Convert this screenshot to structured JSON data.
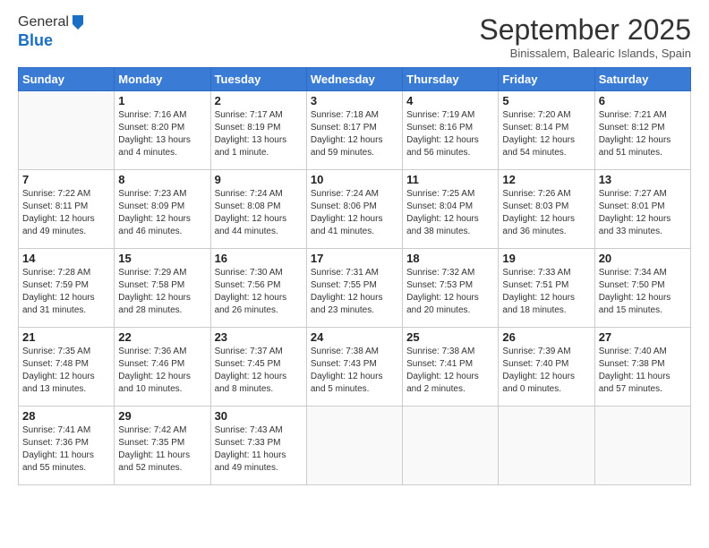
{
  "header": {
    "logo_line1": "General",
    "logo_line2": "Blue",
    "month_title": "September 2025",
    "location": "Binissalem, Balearic Islands, Spain"
  },
  "days_of_week": [
    "Sunday",
    "Monday",
    "Tuesday",
    "Wednesday",
    "Thursday",
    "Friday",
    "Saturday"
  ],
  "weeks": [
    [
      {
        "day": "",
        "info": ""
      },
      {
        "day": "1",
        "info": "Sunrise: 7:16 AM\nSunset: 8:20 PM\nDaylight: 13 hours\nand 4 minutes."
      },
      {
        "day": "2",
        "info": "Sunrise: 7:17 AM\nSunset: 8:19 PM\nDaylight: 13 hours\nand 1 minute."
      },
      {
        "day": "3",
        "info": "Sunrise: 7:18 AM\nSunset: 8:17 PM\nDaylight: 12 hours\nand 59 minutes."
      },
      {
        "day": "4",
        "info": "Sunrise: 7:19 AM\nSunset: 8:16 PM\nDaylight: 12 hours\nand 56 minutes."
      },
      {
        "day": "5",
        "info": "Sunrise: 7:20 AM\nSunset: 8:14 PM\nDaylight: 12 hours\nand 54 minutes."
      },
      {
        "day": "6",
        "info": "Sunrise: 7:21 AM\nSunset: 8:12 PM\nDaylight: 12 hours\nand 51 minutes."
      }
    ],
    [
      {
        "day": "7",
        "info": "Sunrise: 7:22 AM\nSunset: 8:11 PM\nDaylight: 12 hours\nand 49 minutes."
      },
      {
        "day": "8",
        "info": "Sunrise: 7:23 AM\nSunset: 8:09 PM\nDaylight: 12 hours\nand 46 minutes."
      },
      {
        "day": "9",
        "info": "Sunrise: 7:24 AM\nSunset: 8:08 PM\nDaylight: 12 hours\nand 44 minutes."
      },
      {
        "day": "10",
        "info": "Sunrise: 7:24 AM\nSunset: 8:06 PM\nDaylight: 12 hours\nand 41 minutes."
      },
      {
        "day": "11",
        "info": "Sunrise: 7:25 AM\nSunset: 8:04 PM\nDaylight: 12 hours\nand 38 minutes."
      },
      {
        "day": "12",
        "info": "Sunrise: 7:26 AM\nSunset: 8:03 PM\nDaylight: 12 hours\nand 36 minutes."
      },
      {
        "day": "13",
        "info": "Sunrise: 7:27 AM\nSunset: 8:01 PM\nDaylight: 12 hours\nand 33 minutes."
      }
    ],
    [
      {
        "day": "14",
        "info": "Sunrise: 7:28 AM\nSunset: 7:59 PM\nDaylight: 12 hours\nand 31 minutes."
      },
      {
        "day": "15",
        "info": "Sunrise: 7:29 AM\nSunset: 7:58 PM\nDaylight: 12 hours\nand 28 minutes."
      },
      {
        "day": "16",
        "info": "Sunrise: 7:30 AM\nSunset: 7:56 PM\nDaylight: 12 hours\nand 26 minutes."
      },
      {
        "day": "17",
        "info": "Sunrise: 7:31 AM\nSunset: 7:55 PM\nDaylight: 12 hours\nand 23 minutes."
      },
      {
        "day": "18",
        "info": "Sunrise: 7:32 AM\nSunset: 7:53 PM\nDaylight: 12 hours\nand 20 minutes."
      },
      {
        "day": "19",
        "info": "Sunrise: 7:33 AM\nSunset: 7:51 PM\nDaylight: 12 hours\nand 18 minutes."
      },
      {
        "day": "20",
        "info": "Sunrise: 7:34 AM\nSunset: 7:50 PM\nDaylight: 12 hours\nand 15 minutes."
      }
    ],
    [
      {
        "day": "21",
        "info": "Sunrise: 7:35 AM\nSunset: 7:48 PM\nDaylight: 12 hours\nand 13 minutes."
      },
      {
        "day": "22",
        "info": "Sunrise: 7:36 AM\nSunset: 7:46 PM\nDaylight: 12 hours\nand 10 minutes."
      },
      {
        "day": "23",
        "info": "Sunrise: 7:37 AM\nSunset: 7:45 PM\nDaylight: 12 hours\nand 8 minutes."
      },
      {
        "day": "24",
        "info": "Sunrise: 7:38 AM\nSunset: 7:43 PM\nDaylight: 12 hours\nand 5 minutes."
      },
      {
        "day": "25",
        "info": "Sunrise: 7:38 AM\nSunset: 7:41 PM\nDaylight: 12 hours\nand 2 minutes."
      },
      {
        "day": "26",
        "info": "Sunrise: 7:39 AM\nSunset: 7:40 PM\nDaylight: 12 hours\nand 0 minutes."
      },
      {
        "day": "27",
        "info": "Sunrise: 7:40 AM\nSunset: 7:38 PM\nDaylight: 11 hours\nand 57 minutes."
      }
    ],
    [
      {
        "day": "28",
        "info": "Sunrise: 7:41 AM\nSunset: 7:36 PM\nDaylight: 11 hours\nand 55 minutes."
      },
      {
        "day": "29",
        "info": "Sunrise: 7:42 AM\nSunset: 7:35 PM\nDaylight: 11 hours\nand 52 minutes."
      },
      {
        "day": "30",
        "info": "Sunrise: 7:43 AM\nSunset: 7:33 PM\nDaylight: 11 hours\nand 49 minutes."
      },
      {
        "day": "",
        "info": ""
      },
      {
        "day": "",
        "info": ""
      },
      {
        "day": "",
        "info": ""
      },
      {
        "day": "",
        "info": ""
      }
    ]
  ]
}
